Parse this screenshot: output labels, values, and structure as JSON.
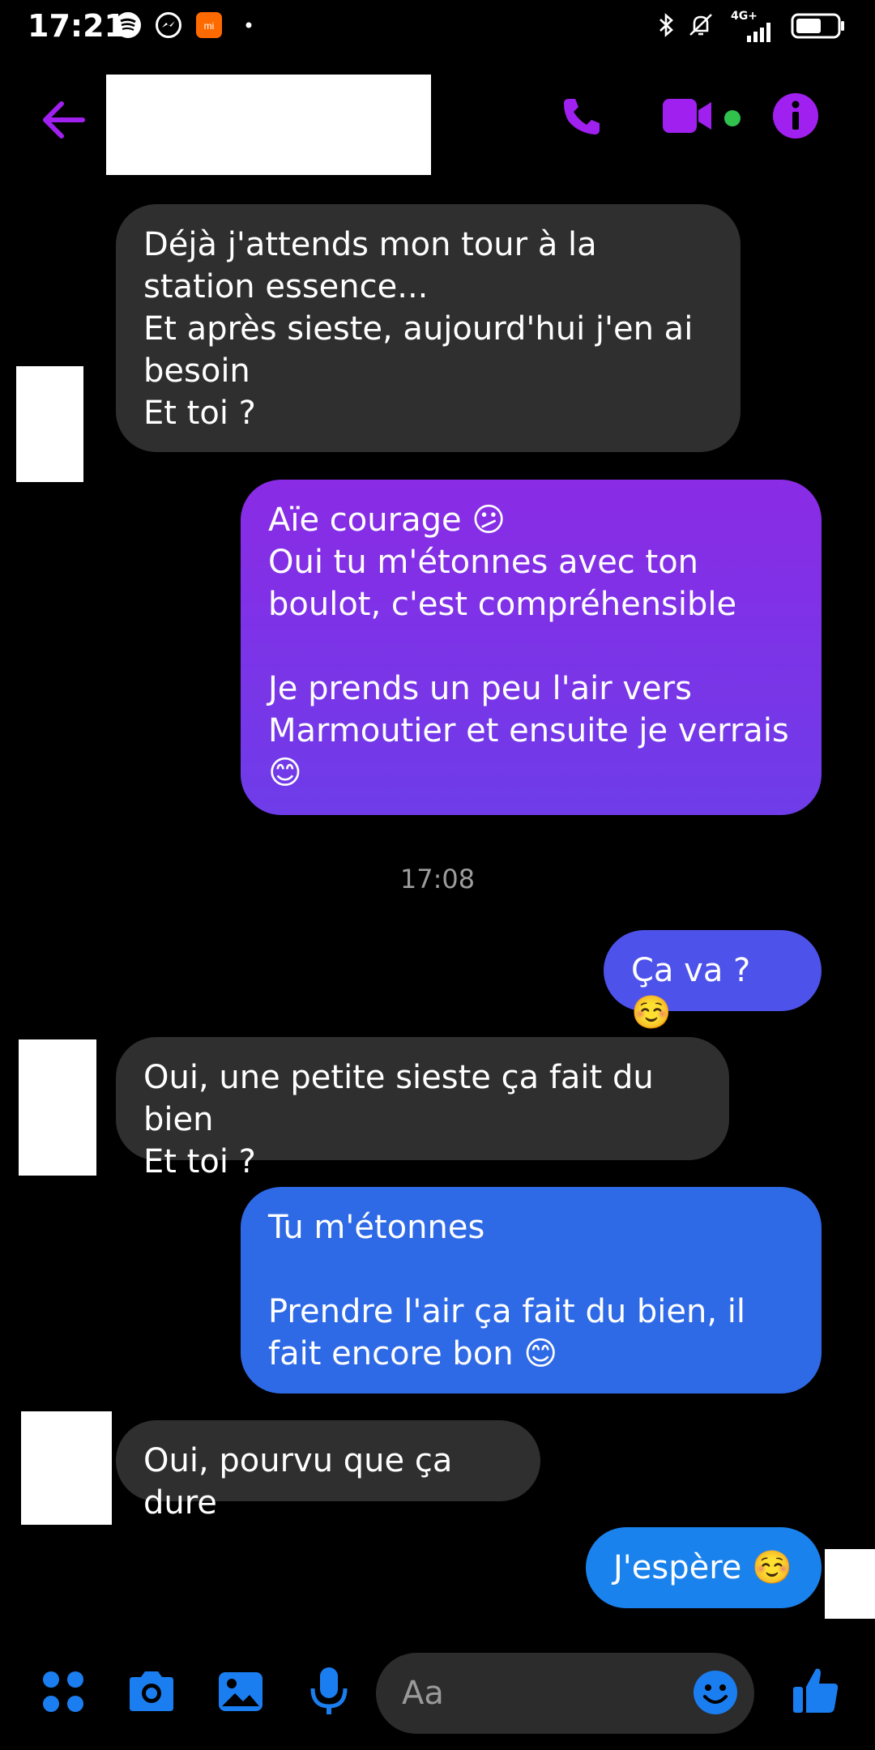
{
  "status_bar": {
    "time": "17:21",
    "network": "4G+"
  },
  "header": {
    "contact_name": "",
    "accent": "#a020f0"
  },
  "messages": [
    {
      "dir": "in",
      "text": "Déjà j'attends mon tour à la station essence...\nEt après sieste, aujourd'hui j'en ai besoin\nEt toi ?"
    },
    {
      "dir": "out",
      "text": "Aïe courage 😕\nOui tu m'étonnes avec ton boulot, c'est compréhensible\n\nJe prends un peu l'air vers Marmoutier et ensuite je verrais 😊"
    },
    {
      "dir": "out",
      "text": "Ça va ? ☺️"
    },
    {
      "dir": "in",
      "text": "Oui, une petite sieste ça fait du bien\nEt toi ?"
    },
    {
      "dir": "out",
      "text": "Tu m'étonnes\n\nPrendre l'air ça fait du bien, il fait encore bon 😊"
    },
    {
      "dir": "in",
      "text": "Oui, pourvu que ça dure"
    },
    {
      "dir": "out",
      "text": "J'espère ☺️"
    }
  ],
  "timestamp": "17:08",
  "composer": {
    "placeholder": "Aa"
  },
  "colors": {
    "incoming_bubble": "#2f2f2f",
    "outgoing_purple": "#7b2ee6",
    "outgoing_blue": "#2f6ae6",
    "outgoing_lightblue": "#1a82ec",
    "composer_blue": "#1b7ef0",
    "online_dot": "#31c24d"
  },
  "icons": [
    "back-arrow-icon",
    "phone-icon",
    "video-camera-icon",
    "info-icon",
    "apps-icon",
    "camera-icon",
    "gallery-icon",
    "microphone-icon",
    "emoji-icon",
    "thumbs-up-icon"
  ]
}
